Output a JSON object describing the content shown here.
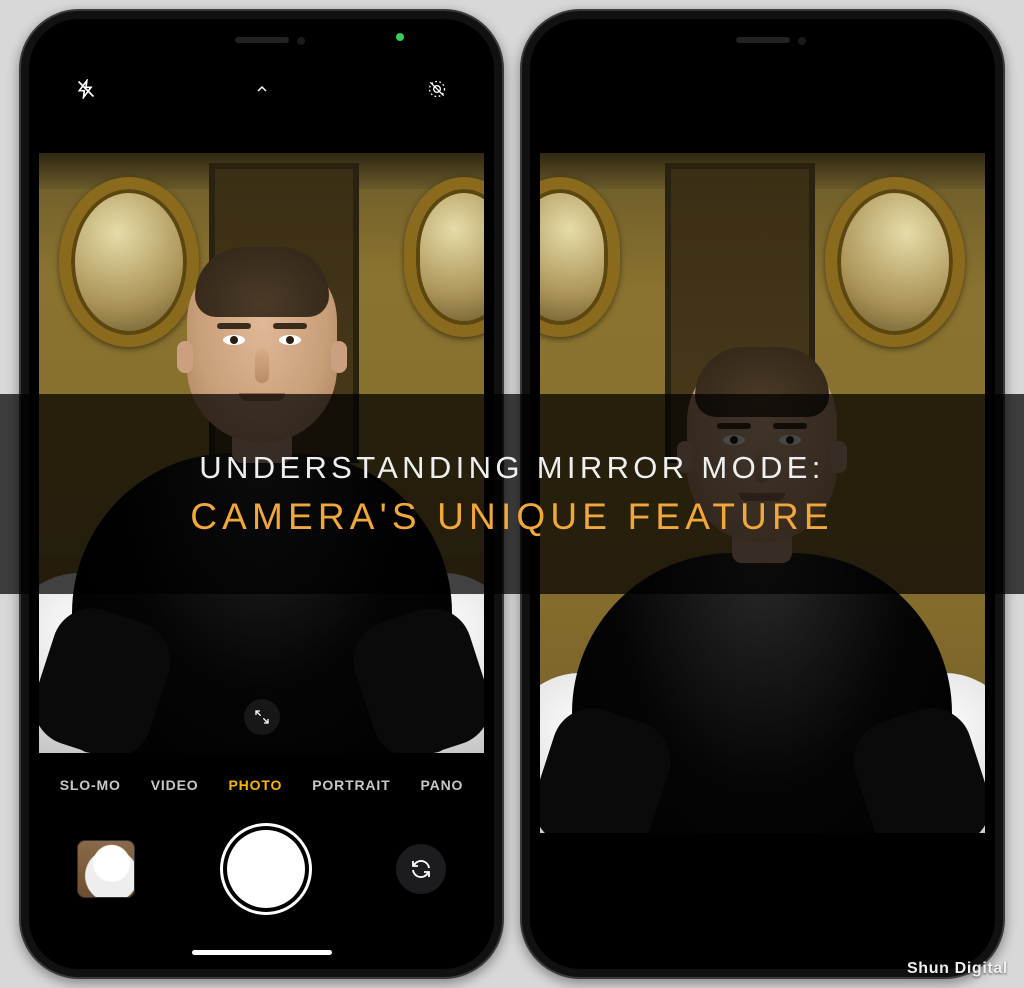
{
  "overlay": {
    "line1": "UNDERSTANDING MIRROR MODE:",
    "line2": "CAMERA'S UNIQUE FEATURE"
  },
  "watermark": "Shun Digital",
  "camera": {
    "top_controls": {
      "flash": "flash-off",
      "expand": "options-chevron",
      "effects": "live-photo-off"
    },
    "zoom_control": "zoom-toggle",
    "modes": {
      "items": [
        "SLO-MO",
        "VIDEO",
        "PHOTO",
        "PORTRAIT",
        "PANO"
      ],
      "active_index": 2
    },
    "bottom": {
      "thumbnail": "last-photo-thumbnail",
      "shutter": "shutter",
      "flip": "camera-flip"
    }
  },
  "colors": {
    "accent_mode": "#f7b500",
    "overlay_accent": "#f2a73a",
    "status_dot": "#30d158"
  }
}
